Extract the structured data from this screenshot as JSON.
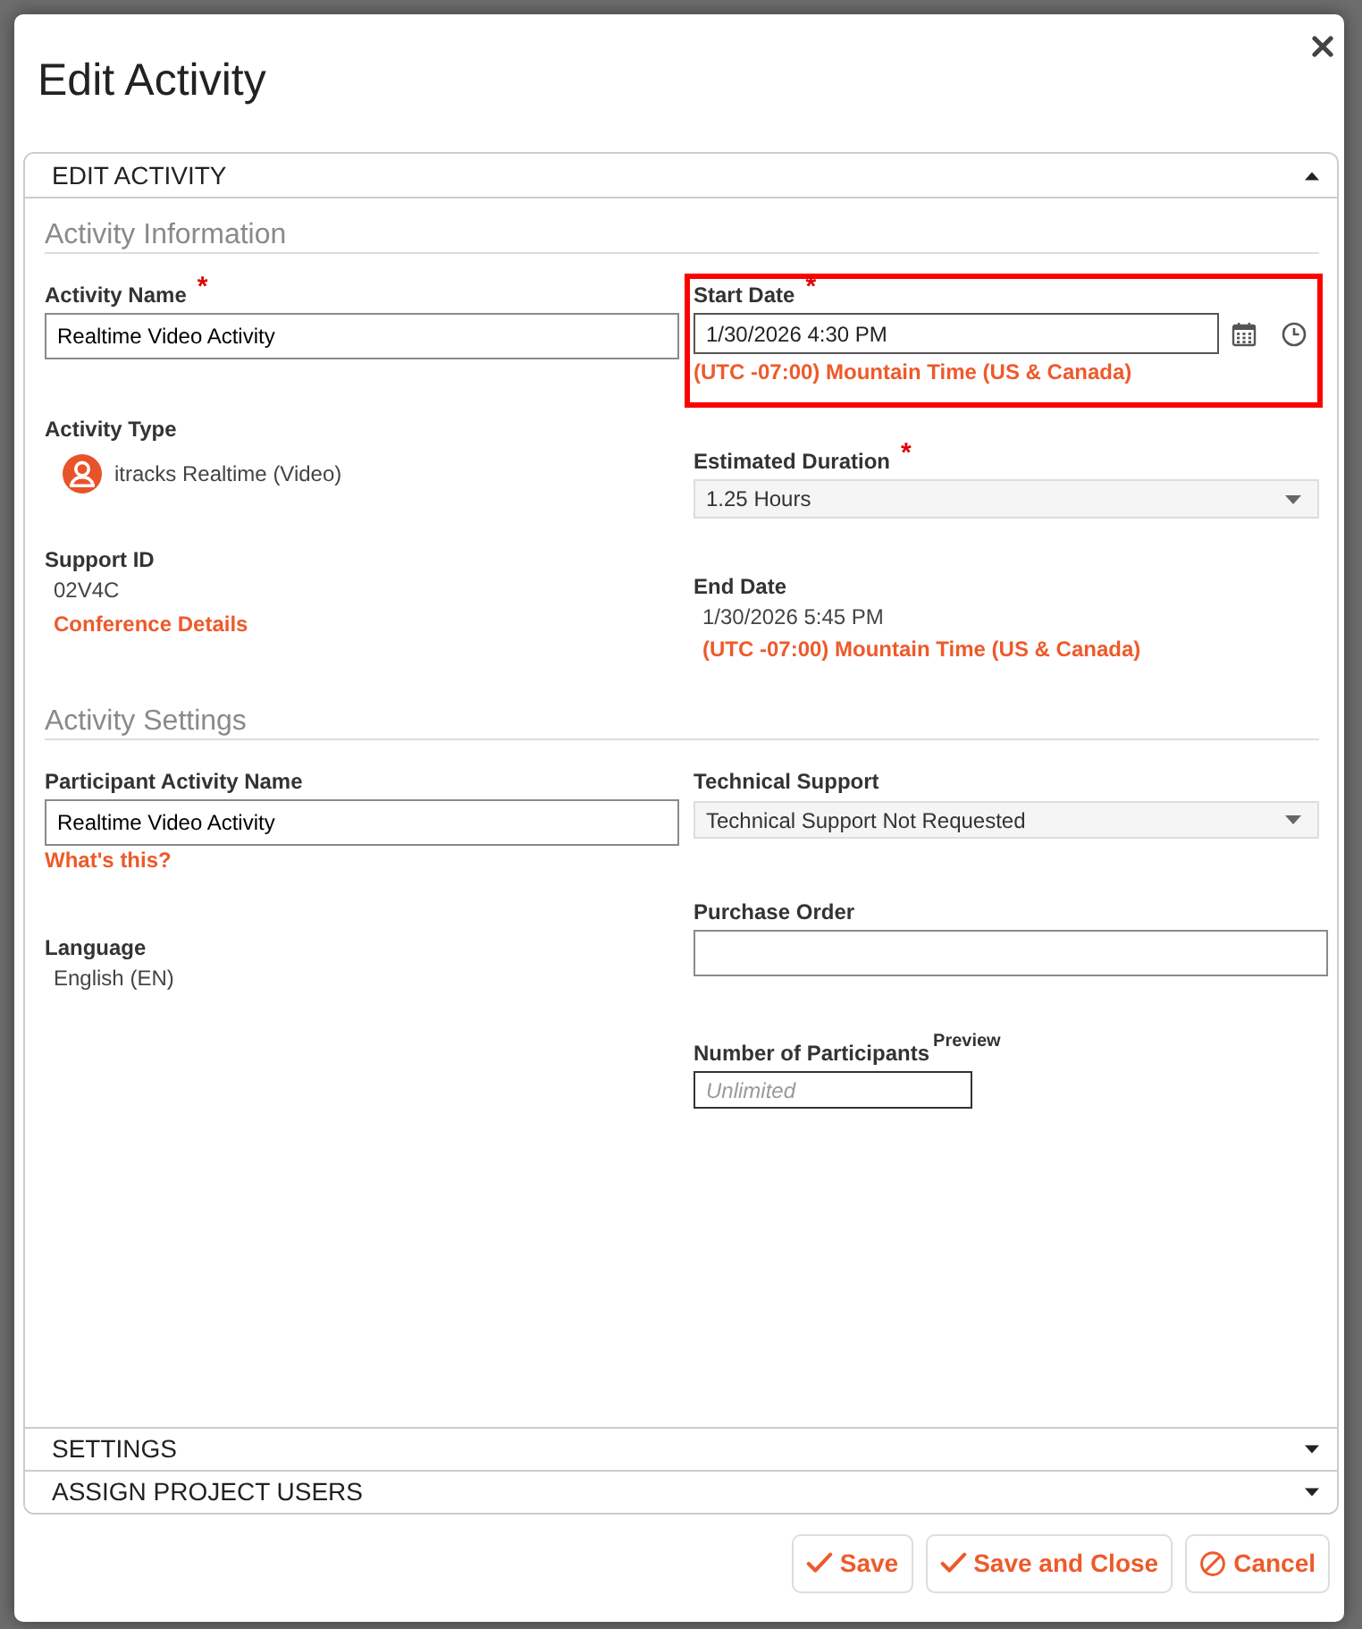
{
  "dialog": {
    "title": "Edit Activity"
  },
  "panels": [
    {
      "title": "EDIT ACTIVITY",
      "expanded": true,
      "sections": [
        {
          "title": "Activity Information",
          "columns": [
            {
              "fields": [
                {
                  "kind": "text_input",
                  "label": "Activity Name",
                  "required_mark": "*",
                  "value": "Realtime Video Activity"
                },
                {
                  "kind": "icon_value",
                  "label": "Activity Type",
                  "value": "itracks Realtime (Video)"
                },
                {
                  "kind": "static",
                  "label": "Support ID",
                  "value": "02V4C",
                  "link": "Conference Details"
                }
              ]
            },
            {
              "fields": [
                {
                  "kind": "datetime",
                  "label": "Start Date",
                  "required_mark": "*",
                  "value": "1/30/2026 4:30 PM",
                  "timezone": "(UTC -07:00) Mountain Time (US & Canada)",
                  "highlighted": true
                },
                {
                  "kind": "select",
                  "label": "Estimated Duration",
                  "required_mark": "*",
                  "value": "1.25 Hours"
                },
                {
                  "kind": "static",
                  "label": "End Date",
                  "value": "1/30/2026 5:45 PM",
                  "timezone": "(UTC -07:00) Mountain Time (US & Canada)"
                }
              ]
            }
          ]
        },
        {
          "title": "Activity Settings",
          "columns": [
            {
              "fields": [
                {
                  "kind": "text_input",
                  "label": "Participant Activity Name",
                  "value": "Realtime Video Activity",
                  "link": "What's this?"
                },
                {
                  "kind": "static",
                  "label": "Language",
                  "value": "English (EN)"
                }
              ]
            },
            {
              "fields": [
                {
                  "kind": "select",
                  "label": "Technical Support",
                  "value": "Technical Support Not Requested"
                },
                {
                  "kind": "text_input",
                  "label": "Purchase Order"
                },
                {
                  "kind": "text_input",
                  "label": "Number of Participants",
                  "label_note": "Preview",
                  "placeholder": "Unlimited"
                }
              ]
            }
          ]
        }
      ]
    },
    {
      "title": "SETTINGS",
      "expanded": false
    },
    {
      "title": "ASSIGN PROJECT USERS",
      "expanded": false
    }
  ],
  "buttons": [
    {
      "label": "Save",
      "kind": "confirm"
    },
    {
      "label": "Save and Close",
      "kind": "confirm"
    },
    {
      "label": "Cancel",
      "kind": "cancel"
    }
  ]
}
